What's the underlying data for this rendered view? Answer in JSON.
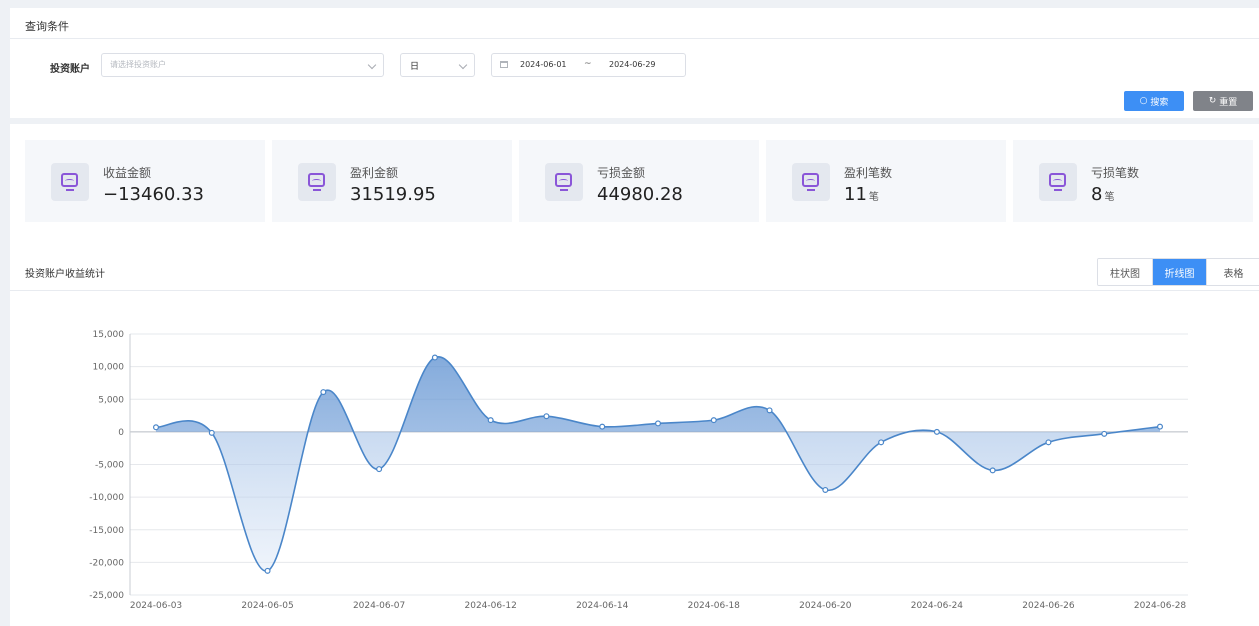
{
  "query": {
    "title": "查询条件",
    "account_label": "投资账户",
    "account_placeholder": "请选择投资账户",
    "period_value": "日",
    "date_start": "2024-06-01",
    "date_sep": "~",
    "date_end": "2024-06-29",
    "search_label": "搜索",
    "reset_label": "重置"
  },
  "stats": [
    {
      "label": "收益金额",
      "value": "−13460.33",
      "unit": ""
    },
    {
      "label": "盈利金额",
      "value": "31519.95",
      "unit": ""
    },
    {
      "label": "亏损金额",
      "value": "44980.28",
      "unit": ""
    },
    {
      "label": "盈利笔数",
      "value": "11",
      "unit": "笔"
    },
    {
      "label": "亏损笔数",
      "value": "8",
      "unit": "笔"
    }
  ],
  "chart_section": {
    "title": "投资账户收益统计",
    "tabs": [
      "柱状图",
      "折线图",
      "表格"
    ],
    "active_tab": "折线图"
  },
  "colors": {
    "accent": "#3d8ff5",
    "line": "#4a86c9",
    "icon": "#8a56d8"
  },
  "chart_data": {
    "type": "area",
    "ylim": [
      -25000,
      15000
    ],
    "yticks": [
      "15,000",
      "10,000",
      "5,000",
      "0",
      "-5,000",
      "-10,000",
      "-15,000",
      "-20,000",
      "-25,000"
    ],
    "ytick_values": [
      15000,
      10000,
      5000,
      0,
      -5000,
      -10000,
      -15000,
      -20000,
      -25000
    ],
    "xtick_labels": [
      "2024-06-03",
      "2024-06-05",
      "2024-06-07",
      "2024-06-12",
      "2024-06-14",
      "2024-06-18",
      "2024-06-20",
      "2024-06-24",
      "2024-06-26",
      "2024-06-28"
    ],
    "series": [
      {
        "values": [
          700,
          -150,
          -21300,
          6100,
          -5700,
          11400,
          1800,
          2400,
          800,
          1300,
          1800,
          3300,
          -8900,
          -1600,
          0,
          -5900,
          -1600,
          -300,
          800
        ]
      }
    ]
  }
}
